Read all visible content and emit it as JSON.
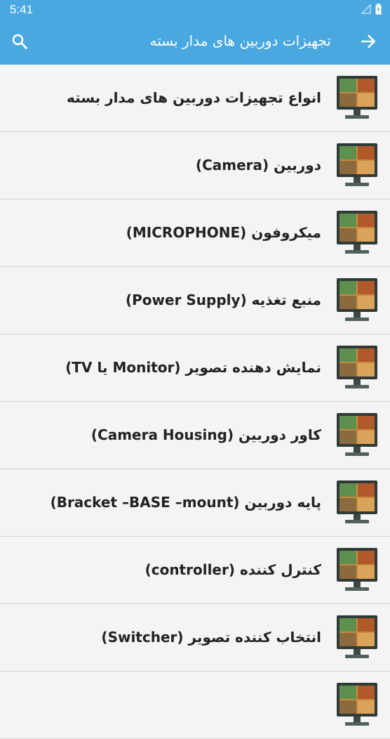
{
  "status_bar": {
    "time": "5:41"
  },
  "app_bar": {
    "title": "تجهیزات دوربین های مدار بسته",
    "back_icon": "arrow-right-icon",
    "search_icon": "search-icon"
  },
  "list": {
    "items": [
      {
        "label": "انواع تجهیزات دوربین های مدار بسته",
        "icon": "cctv-monitor-thumbnail"
      },
      {
        "label": "دوربین (Camera)",
        "icon": "cctv-monitor-thumbnail"
      },
      {
        "label": "میکروفون (MICROPHONE)",
        "icon": "cctv-monitor-thumbnail"
      },
      {
        "label": "منبع تغذیه (Power Supply)",
        "icon": "cctv-monitor-thumbnail"
      },
      {
        "label": "نمایش دهنده تصویر (Monitor یا TV)",
        "icon": "cctv-monitor-thumbnail"
      },
      {
        "label": "کاور دوربین (Camera Housing)",
        "icon": "cctv-monitor-thumbnail"
      },
      {
        "label": "پایه دوربین (Bracket –BASE –mount)",
        "icon": "cctv-monitor-thumbnail"
      },
      {
        "label": "کنترل کننده (controller)",
        "icon": "cctv-monitor-thumbnail"
      },
      {
        "label": "انتخاب کننده تصویر (Switcher)",
        "icon": "cctv-monitor-thumbnail"
      },
      {
        "label": "",
        "icon": "cctv-monitor-thumbnail"
      }
    ]
  },
  "colors": {
    "primary": "#4aa8e0",
    "background": "#f4f4f4",
    "divider": "#d4d4d4",
    "text": "#222222"
  }
}
